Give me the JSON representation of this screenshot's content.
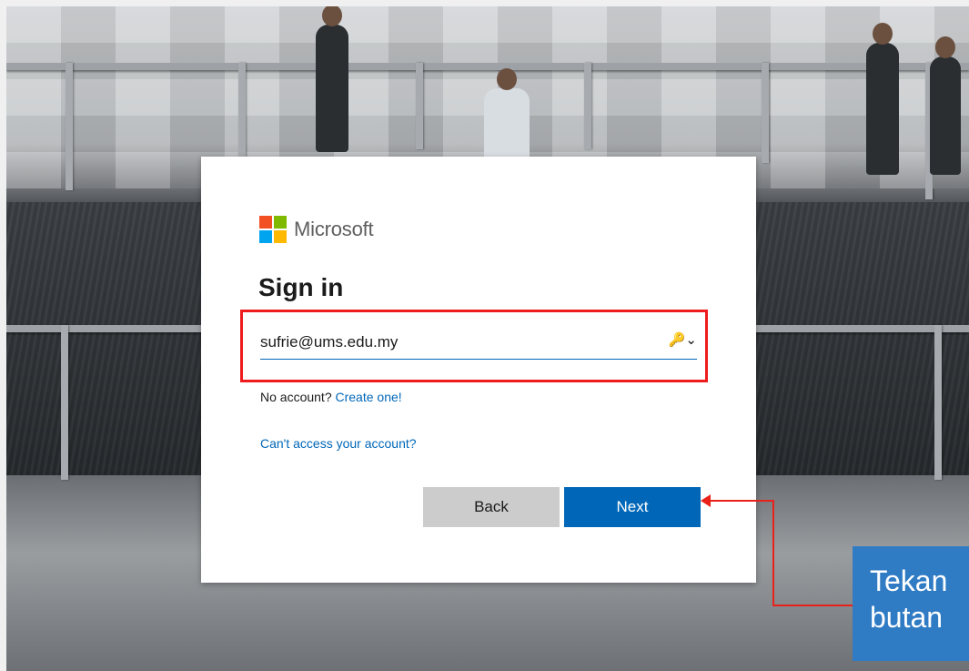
{
  "brand": {
    "name": "Microsoft"
  },
  "signin": {
    "title": "Sign in",
    "email_value": "sufrie@ums.edu.my",
    "key_icon_glyph": "🔑⌄",
    "no_account_text": "No account?",
    "create_link": "Create one!",
    "cant_access_link": "Can't access your account?"
  },
  "buttons": {
    "back": "Back",
    "next": "Next"
  },
  "annotation": {
    "callout_line1": "Tekan",
    "callout_line2": "butan"
  },
  "colors": {
    "accent": "#0067b8",
    "annotation_red": "#e8221a",
    "callout_blue": "#2f7bc4",
    "logo": [
      "#f25022",
      "#7fba00",
      "#00a4ef",
      "#ffb900"
    ]
  }
}
